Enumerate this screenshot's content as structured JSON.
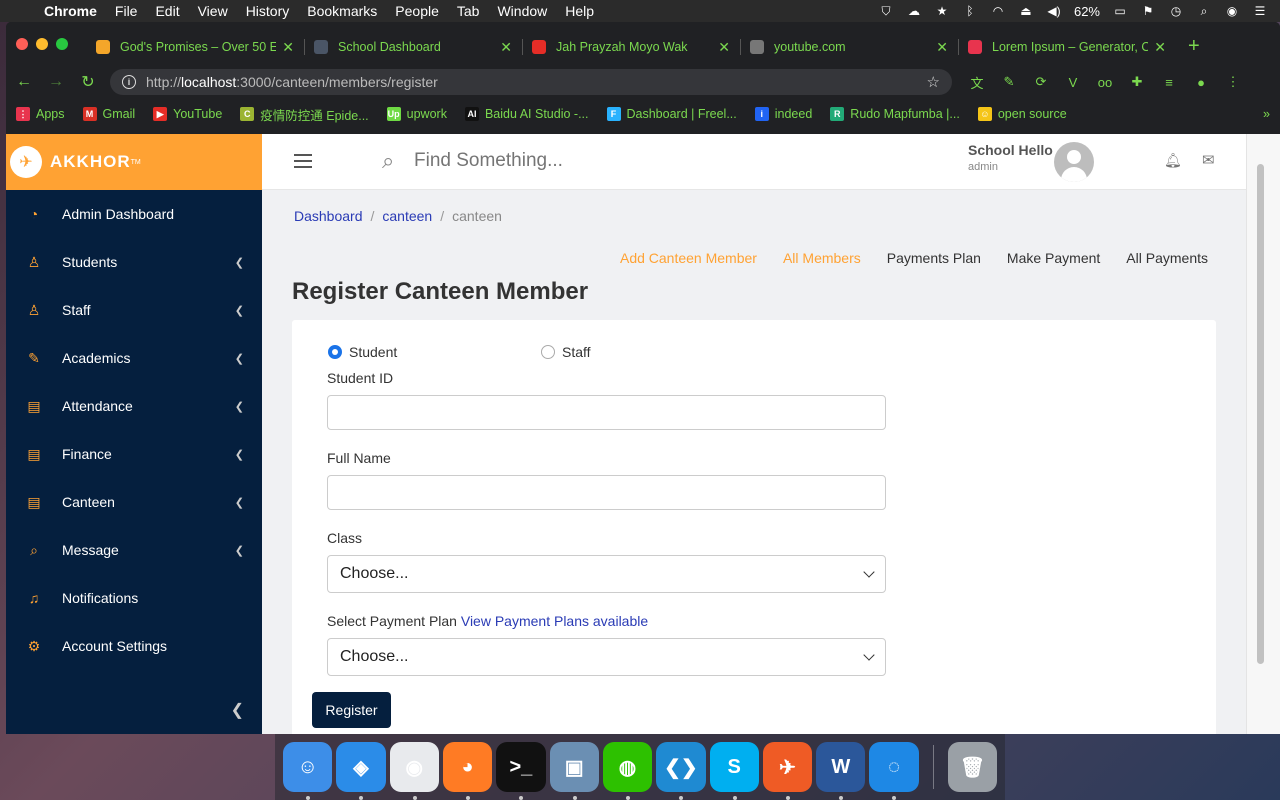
{
  "menubar": {
    "items": [
      "Chrome",
      "File",
      "Edit",
      "View",
      "History",
      "Bookmarks",
      "People",
      "Tab",
      "Window",
      "Help"
    ],
    "battery": "62%"
  },
  "browser": {
    "tabs": [
      {
        "title": "God's Promises – Over 50 E",
        "color": "#f4a62a"
      },
      {
        "title": "School Dashboard",
        "color": "#4a5566"
      },
      {
        "title": "Jah Prayzah Moyo Wak",
        "color": "#e52d27"
      },
      {
        "title": "youtube.com",
        "color": "#777"
      },
      {
        "title": "Lorem Ipsum – Generator, O",
        "color": "#e8344e"
      }
    ],
    "url_prefix": "http://",
    "url_host": "localhost",
    "url_path": ":3000/canteen/members/register",
    "bookmarks": [
      {
        "label": "Apps",
        "color": "#e8344e",
        "glyph": "⋮"
      },
      {
        "label": "Gmail",
        "color": "#d93025",
        "glyph": "M"
      },
      {
        "label": "YouTube",
        "color": "#e52d27",
        "glyph": "▶"
      },
      {
        "label": "疫情防控通 Epide...",
        "color": "#9bb432",
        "glyph": "C"
      },
      {
        "label": "upwork",
        "color": "#6fda44",
        "glyph": "Up"
      },
      {
        "label": "Baidu AI Studio -...",
        "color": "#111",
        "glyph": "AI"
      },
      {
        "label": "Dashboard | Freel...",
        "color": "#29b2fe",
        "glyph": "F"
      },
      {
        "label": "indeed",
        "color": "#2164f3",
        "glyph": "i"
      },
      {
        "label": "Rudo Mapfumba |...",
        "color": "#2a7",
        "glyph": "R"
      },
      {
        "label": "open source",
        "color": "#f5c518",
        "glyph": "☺"
      }
    ],
    "more": "»"
  },
  "sidebar": {
    "brand": "AKKHOR",
    "tm": "TM",
    "items": [
      {
        "label": "Admin Dashboard",
        "icon": "dashboard-icon",
        "glyph": "◔",
        "chevron": false
      },
      {
        "label": "Students",
        "icon": "students-icon",
        "glyph": "♙",
        "chevron": true
      },
      {
        "label": "Staff",
        "icon": "staff-icon",
        "glyph": "♙",
        "chevron": true
      },
      {
        "label": "Academics",
        "icon": "academics-icon",
        "glyph": "✎",
        "chevron": true
      },
      {
        "label": "Attendance",
        "icon": "attendance-icon",
        "glyph": "▤",
        "chevron": true
      },
      {
        "label": "Finance",
        "icon": "finance-icon",
        "glyph": "▤",
        "chevron": true
      },
      {
        "label": "Canteen",
        "icon": "canteen-icon",
        "glyph": "▤",
        "chevron": true
      },
      {
        "label": "Message",
        "icon": "message-icon",
        "glyph": "⌕",
        "chevron": true
      },
      {
        "label": "Notifications",
        "icon": "notifications-icon",
        "glyph": "♫",
        "chevron": false
      },
      {
        "label": "Account Settings",
        "icon": "settings-icon",
        "glyph": "⚙",
        "chevron": false
      }
    ]
  },
  "topbar": {
    "search_placeholder": "Find Something...",
    "user_name": "School Hello",
    "user_role": "admin"
  },
  "breadcrumb": {
    "items": [
      "Dashboard",
      "canteen",
      "canteen"
    ],
    "separator": "/"
  },
  "subnav": {
    "items": [
      {
        "label": "Add Canteen Member",
        "active": true
      },
      {
        "label": "All Members",
        "active": true
      },
      {
        "label": "Payments Plan",
        "active": false
      },
      {
        "label": "Make Payment",
        "active": false
      },
      {
        "label": "All Payments",
        "active": false
      }
    ]
  },
  "form": {
    "title": "Register Canteen Member",
    "radio_student": "Student",
    "radio_staff": "Staff",
    "selected_type": "Student",
    "student_id_label": "Student ID",
    "student_id_value": "",
    "full_name_label": "Full Name",
    "full_name_value": "",
    "class_label": "Class",
    "class_value": "Choose...",
    "plan_label": "Select Payment Plan",
    "plan_link": "View Payment Plans available",
    "plan_value": "Choose...",
    "submit": "Register"
  },
  "dock": [
    {
      "name": "finder-icon",
      "color": "#3d8ee8",
      "glyph": "☺"
    },
    {
      "name": "safari-icon",
      "color": "#2b8ce8",
      "glyph": "◈"
    },
    {
      "name": "chrome-icon",
      "color": "#e8eaed",
      "glyph": "◉"
    },
    {
      "name": "firefox-icon",
      "color": "#ff7b24",
      "glyph": "◕"
    },
    {
      "name": "terminal-icon",
      "color": "#111",
      "glyph": ">_"
    },
    {
      "name": "preview-icon",
      "color": "#6b8fb3",
      "glyph": "▣"
    },
    {
      "name": "wechat-icon",
      "color": "#2dc100",
      "glyph": "◍"
    },
    {
      "name": "vscode-icon",
      "color": "#1f8ad2",
      "glyph": "❮❯"
    },
    {
      "name": "skype-icon",
      "color": "#00aff0",
      "glyph": "S"
    },
    {
      "name": "postman-icon",
      "color": "#ef5b25",
      "glyph": "✈"
    },
    {
      "name": "word-icon",
      "color": "#2b579a",
      "glyph": "W"
    },
    {
      "name": "edge-icon",
      "color": "#1e88e5",
      "glyph": "◌"
    },
    {
      "name": "trash-icon",
      "color": "#9aa0a6",
      "glyph": "🗑"
    }
  ]
}
